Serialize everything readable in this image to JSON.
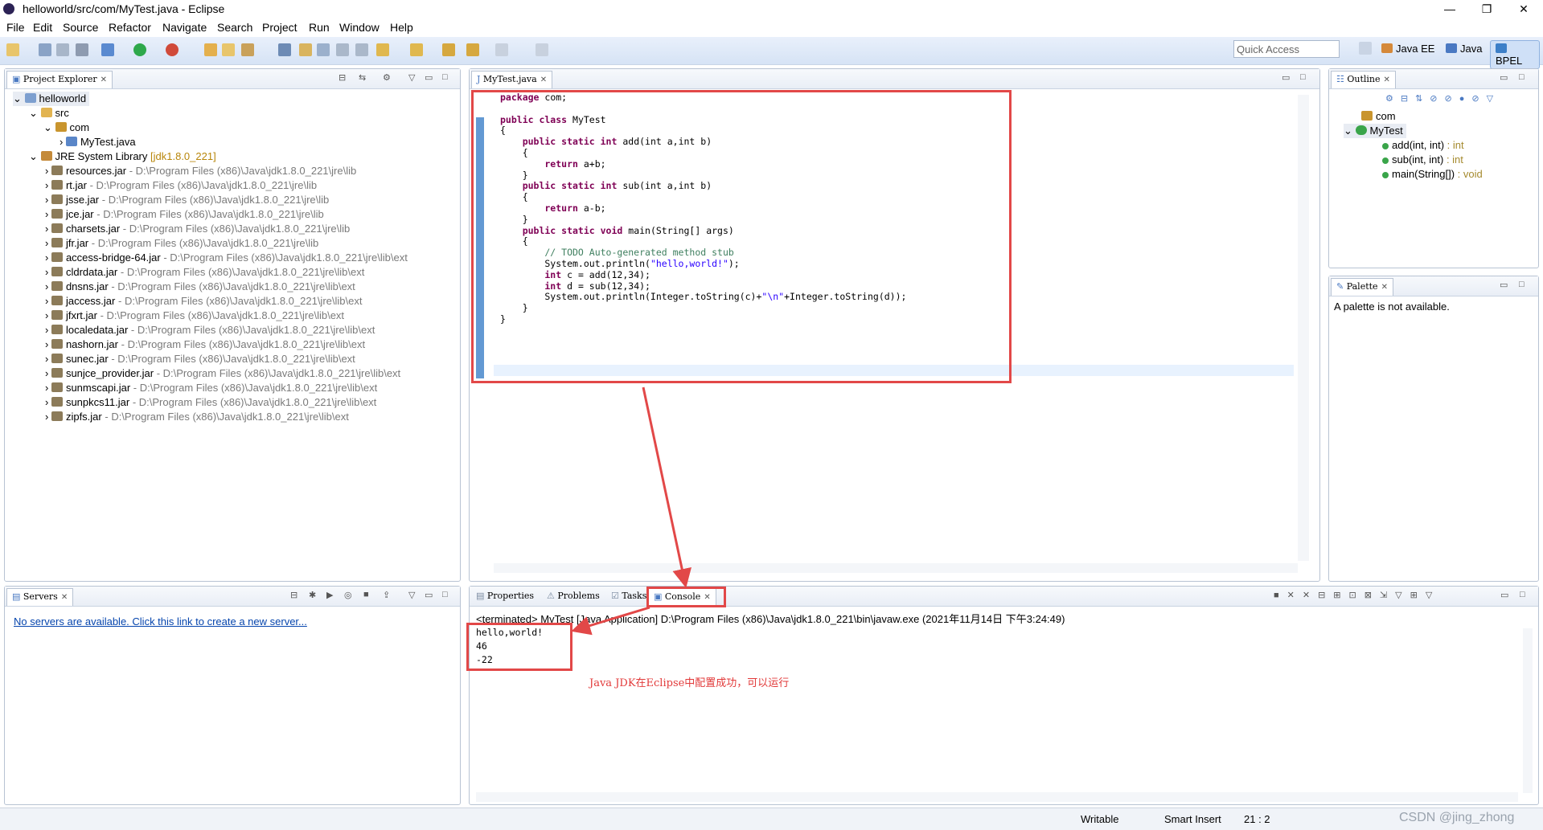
{
  "window": {
    "title": "helloworld/src/com/MyTest.java - Eclipse",
    "controls": [
      "—",
      "❐",
      "✕"
    ]
  },
  "menu": [
    "File",
    "Edit",
    "Source",
    "Refactor",
    "Navigate",
    "Search",
    "Project",
    "Run",
    "Window",
    "Help"
  ],
  "toolbar": {
    "quick_access": "Quick Access",
    "perspectives": [
      "Java EE",
      "Java",
      "BPEL"
    ]
  },
  "project_explorer": {
    "title": "Project Explorer",
    "project": "helloworld",
    "src": "src",
    "package": "com",
    "file": "MyTest.java",
    "jre": {
      "label": "JRE System Library",
      "version": "[jdk1.8.0_221]"
    },
    "jars": [
      {
        "name": "resources.jar",
        "path": "D:\\Program Files (x86)\\Java\\jdk1.8.0_221\\jre\\lib"
      },
      {
        "name": "rt.jar",
        "path": "D:\\Program Files (x86)\\Java\\jdk1.8.0_221\\jre\\lib"
      },
      {
        "name": "jsse.jar",
        "path": "D:\\Program Files (x86)\\Java\\jdk1.8.0_221\\jre\\lib"
      },
      {
        "name": "jce.jar",
        "path": "D:\\Program Files (x86)\\Java\\jdk1.8.0_221\\jre\\lib"
      },
      {
        "name": "charsets.jar",
        "path": "D:\\Program Files (x86)\\Java\\jdk1.8.0_221\\jre\\lib"
      },
      {
        "name": "jfr.jar",
        "path": "D:\\Program Files (x86)\\Java\\jdk1.8.0_221\\jre\\lib"
      },
      {
        "name": "access-bridge-64.jar",
        "path": "D:\\Program Files (x86)\\Java\\jdk1.8.0_221\\jre\\lib\\ext"
      },
      {
        "name": "cldrdata.jar",
        "path": "D:\\Program Files (x86)\\Java\\jdk1.8.0_221\\jre\\lib\\ext"
      },
      {
        "name": "dnsns.jar",
        "path": "D:\\Program Files (x86)\\Java\\jdk1.8.0_221\\jre\\lib\\ext"
      },
      {
        "name": "jaccess.jar",
        "path": "D:\\Program Files (x86)\\Java\\jdk1.8.0_221\\jre\\lib\\ext"
      },
      {
        "name": "jfxrt.jar",
        "path": "D:\\Program Files (x86)\\Java\\jdk1.8.0_221\\jre\\lib\\ext"
      },
      {
        "name": "localedata.jar",
        "path": "D:\\Program Files (x86)\\Java\\jdk1.8.0_221\\jre\\lib\\ext"
      },
      {
        "name": "nashorn.jar",
        "path": "D:\\Program Files (x86)\\Java\\jdk1.8.0_221\\jre\\lib\\ext"
      },
      {
        "name": "sunec.jar",
        "path": "D:\\Program Files (x86)\\Java\\jdk1.8.0_221\\jre\\lib\\ext"
      },
      {
        "name": "sunjce_provider.jar",
        "path": "D:\\Program Files (x86)\\Java\\jdk1.8.0_221\\jre\\lib\\ext"
      },
      {
        "name": "sunmscapi.jar",
        "path": "D:\\Program Files (x86)\\Java\\jdk1.8.0_221\\jre\\lib\\ext"
      },
      {
        "name": "sunpkcs11.jar",
        "path": "D:\\Program Files (x86)\\Java\\jdk1.8.0_221\\jre\\lib\\ext"
      },
      {
        "name": "zipfs.jar",
        "path": "D:\\Program Files (x86)\\Java\\jdk1.8.0_221\\jre\\lib\\ext"
      }
    ]
  },
  "servers": {
    "title": "Servers",
    "link": "No servers are available. Click this link to create a new server..."
  },
  "editor": {
    "tab": "MyTest.java",
    "lines": [
      [
        [
          "kw",
          "package"
        ],
        [
          "",
          "com;"
        ]
      ],
      [],
      [
        [
          "kw",
          "public class"
        ],
        [
          "",
          "MyTest"
        ]
      ],
      [
        [
          "",
          "{"
        ]
      ],
      [
        [
          "kw",
          "    public static int"
        ],
        [
          "",
          "add(int a,int b)"
        ]
      ],
      [
        [
          "",
          "    {"
        ]
      ],
      [
        [
          "kw",
          "        return"
        ],
        [
          "",
          "a+b;"
        ]
      ],
      [
        [
          "",
          "    }"
        ]
      ],
      [
        [
          "kw",
          "    public static int"
        ],
        [
          "",
          "sub(int a,int b)"
        ]
      ],
      [
        [
          "",
          "    {"
        ]
      ],
      [
        [
          "kw",
          "        return"
        ],
        [
          "",
          "a-b;"
        ]
      ],
      [
        [
          "",
          "    }"
        ]
      ],
      [
        [
          "kw",
          "    public static void"
        ],
        [
          "",
          "main(String[] args)"
        ]
      ],
      [
        [
          "",
          "    {"
        ]
      ],
      [
        [
          "cm",
          "        // TODO Auto-generated method stub"
        ]
      ],
      [
        [
          "",
          "        System.out.println("
        ],
        [
          "str",
          "\"hello,world!\""
        ],
        [
          "",
          ");"
        ]
      ],
      [
        [
          "kw",
          "        int"
        ],
        [
          "",
          "c = add(12,34);"
        ]
      ],
      [
        [
          "kw",
          "        int"
        ],
        [
          "",
          "d = sub(12,34);"
        ]
      ],
      [
        [
          "",
          "        System.out.println(Integer.toString(c)+"
        ],
        [
          "str",
          "\"\\n\""
        ],
        [
          "",
          "+Integer.toString(d));"
        ]
      ],
      [
        [
          "",
          "    }"
        ]
      ],
      [
        [
          "",
          "}"
        ]
      ]
    ]
  },
  "outline": {
    "title": "Outline",
    "package": "com",
    "class": "MyTest",
    "members": [
      {
        "name": "add(int, int)",
        "type": ": int"
      },
      {
        "name": "sub(int, int)",
        "type": ": int"
      },
      {
        "name": "main(String[])",
        "type": ": void"
      }
    ]
  },
  "palette": {
    "title": "Palette",
    "message": "A palette is not available."
  },
  "bottom_tabs": [
    "Properties",
    "Problems",
    "Tasks",
    "Console"
  ],
  "console": {
    "header": "<terminated> MyTest [Java Application] D:\\Program Files (x86)\\Java\\jdk1.8.0_221\\bin\\javaw.exe (2021年11月14日 下午3:24:49)",
    "output": [
      "hello,world!",
      "46",
      "-22"
    ],
    "annotation": "Java JDK在Eclipse中配置成功，可以运行"
  },
  "status": {
    "writable": "Writable",
    "insert": "Smart Insert",
    "position": "21 : 2",
    "watermark": "CSDN @jing_zhong"
  },
  "colors": {
    "annotation_red": "#e24848",
    "keyword": "#7f0055",
    "comment": "#3f7f5f",
    "string": "#2a00ff",
    "link": "#0645ad"
  }
}
